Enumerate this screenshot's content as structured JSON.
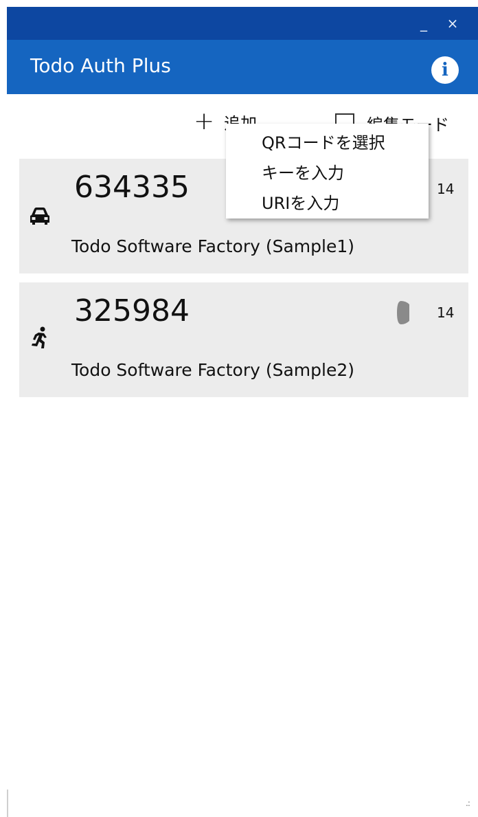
{
  "window": {
    "minimize_label": "_",
    "close_label": "×"
  },
  "appbar": {
    "title": "Todo Auth Plus",
    "info_label": "i"
  },
  "toolbar": {
    "add_icon": "+",
    "add_label": "追加",
    "edit_mode_label": "編集モード"
  },
  "add_menu": {
    "items": [
      {
        "label": "QRコードを選択"
      },
      {
        "label": "キーを入力"
      },
      {
        "label": "URIを入力"
      }
    ]
  },
  "accounts": [
    {
      "code": "634335",
      "name": "Todo Software Factory (Sample1)",
      "icon": "car-icon",
      "seconds": "14"
    },
    {
      "code": "325984",
      "name": "Todo Software Factory (Sample2)",
      "icon": "running-person-icon",
      "seconds": "14"
    }
  ],
  "colors": {
    "titlebar": "#0d47a1",
    "appbar": "#1565c0",
    "card_bg": "#ececec",
    "timer": "#8a8a8a"
  }
}
